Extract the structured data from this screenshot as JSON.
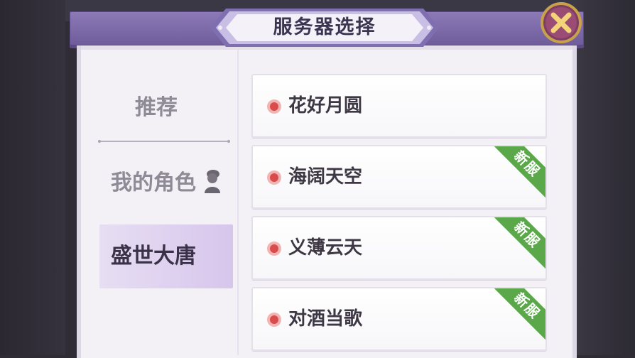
{
  "header": {
    "title": "服务器选择"
  },
  "close_button": {
    "icon": "close-icon",
    "label": "✕"
  },
  "sidebar": {
    "items": [
      {
        "label": "推荐"
      },
      {
        "label": "我的角色",
        "icon": "character-icon"
      },
      {
        "label": "盛世大唐",
        "active": true
      }
    ]
  },
  "servers": [
    {
      "name": "花好月圆",
      "tag": ""
    },
    {
      "name": "海阔天空",
      "tag": "新服"
    },
    {
      "name": "义薄云天",
      "tag": "新服"
    },
    {
      "name": "对酒当歌",
      "tag": "新服"
    }
  ],
  "colors": {
    "accent": "#8c79b6",
    "new_tag": "#5aa84a",
    "status_dot": "#d94c4c"
  }
}
